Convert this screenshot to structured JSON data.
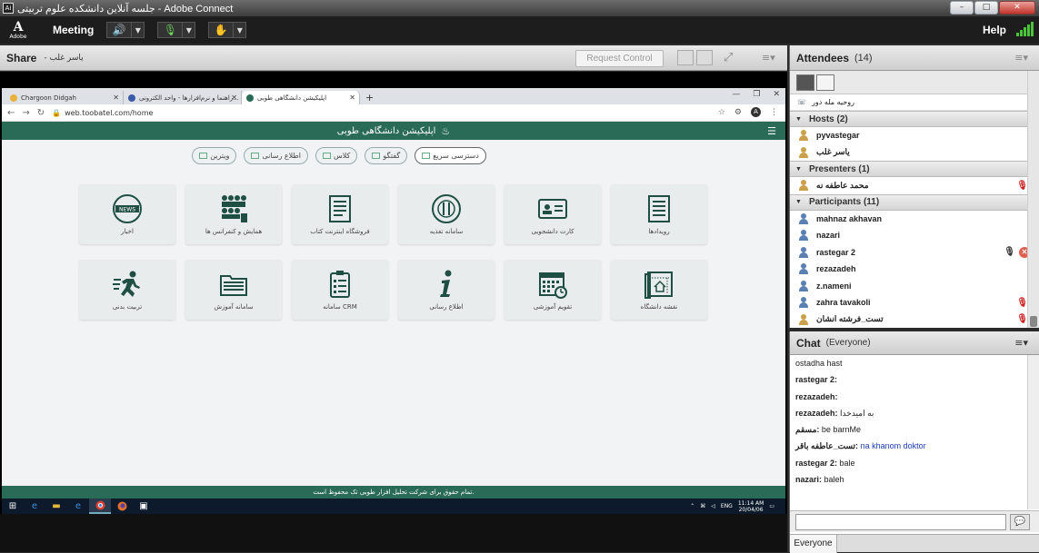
{
  "window": {
    "title": "جلسه آنلاین دانشکده علوم تربیتی - Adobe Connect",
    "icon_label": "Ai",
    "controls": [
      "–",
      "□",
      "✕"
    ]
  },
  "menubar": {
    "logo": "Adobe",
    "meeting_label": "Meeting",
    "help_label": "Help"
  },
  "share": {
    "title": "Share",
    "presenter": "- یاسر غلب",
    "request_control": "Request Control"
  },
  "browser": {
    "tabs": [
      {
        "label": "Chargoon Didgah",
        "active": false
      },
      {
        "label": "راهنما و نرم‌افزارها - واحد الکترونی...",
        "active": false
      },
      {
        "label": "اپلیکیشن دانشگاهی طوبی",
        "active": true
      }
    ],
    "url": "web.toobatel.com/home",
    "profile_initial": "A"
  },
  "site": {
    "header_title": "اپلیکیشن دانشگاهی طوبی",
    "pills": [
      "دسترسی سریع",
      "گفتگو",
      "کلاس",
      "اطلاع رسانی",
      "ویترین"
    ],
    "cards": [
      {
        "label": "اخبار",
        "icon": "news-icon"
      },
      {
        "label": "همایش و کنفرانس ها",
        "icon": "conference-icon"
      },
      {
        "label": "فروشگاه اینترنت کتاب",
        "icon": "book-store-icon"
      },
      {
        "label": "سامانه تغذیه",
        "icon": "food-icon"
      },
      {
        "label": "کارت دانشجویی",
        "icon": "id-card-icon"
      },
      {
        "label": "رویدادها",
        "icon": "events-icon"
      },
      {
        "label": "تربیت بدنی",
        "icon": "sport-icon"
      },
      {
        "label": "سامانه آموزش",
        "icon": "folder-icon"
      },
      {
        "label": "سامانه CRM",
        "icon": "crm-icon"
      },
      {
        "label": "اطلاع رسانی",
        "icon": "info-icon"
      },
      {
        "label": "تقویم آموزشی",
        "icon": "calendar-icon"
      },
      {
        "label": "نقشه دانشگاه",
        "icon": "map-icon"
      }
    ],
    "footer": "تمام حقوق برای شرکت تحلیل افزار طوبی تک محفوظ است."
  },
  "taskbar": {
    "lang": "ENG",
    "time": "11:14 AM",
    "date": "20/04/06"
  },
  "attendees": {
    "title": "Attendees",
    "count": "(14)",
    "dialin": "روحیه مله دور",
    "groups": [
      {
        "name": "Hosts (2)",
        "people": [
          {
            "name": "pyvastegar",
            "type": "host"
          },
          {
            "name": "یاسر غلب",
            "type": "host"
          }
        ]
      },
      {
        "name": "Presenters (1)",
        "people": [
          {
            "name": "محمد عاطفه نه",
            "type": "presenter",
            "mic": "off"
          }
        ]
      },
      {
        "name": "Participants (11)",
        "people": [
          {
            "name": "mahnaz akhavan",
            "type": "participant"
          },
          {
            "name": "nazari",
            "type": "participant"
          },
          {
            "name": "rastegar 2",
            "type": "participant",
            "mic": "on",
            "status": "x"
          },
          {
            "name": "rezazadeh",
            "type": "participant"
          },
          {
            "name": "z.nameni",
            "type": "participant"
          },
          {
            "name": "zahra tavakoli",
            "type": "participant",
            "mic": "off"
          },
          {
            "name": "تست_فرشته انشان",
            "type": "host",
            "mic": "off"
          }
        ]
      }
    ]
  },
  "chat": {
    "title": "Chat",
    "scope": "(Everyone)",
    "messages": [
      {
        "sender": "",
        "text": "ostadha hast",
        "blue": false
      },
      {
        "sender": "rastegar 2:",
        "text": "",
        "blue": false
      },
      {
        "sender": "rezazadeh:",
        "text": "",
        "blue": false
      },
      {
        "sender": "rezazadeh:",
        "text": "به امیدخدا",
        "blue": false
      },
      {
        "sender": "مسقم:",
        "text": "be barnMe",
        "blue": false
      },
      {
        "sender": "تست_عاطفه باقر:",
        "text": "na khanom doktor",
        "blue": true
      },
      {
        "sender": "rastegar 2:",
        "text": "bale",
        "blue": false
      },
      {
        "sender": "nazari:",
        "text": "baleh",
        "blue": false
      }
    ],
    "tab": "Everyone"
  },
  "colors": {
    "site_green": "#2a6b58",
    "mic_green": "#6fd35a"
  }
}
